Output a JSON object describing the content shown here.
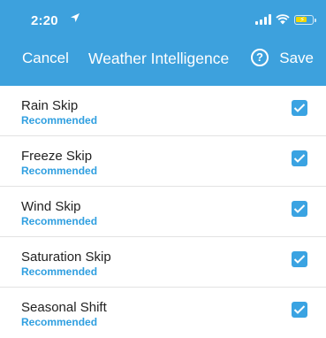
{
  "status_bar": {
    "time": "2:20",
    "icons": [
      "location-arrow-icon",
      "signal-icon",
      "wifi-icon",
      "battery-icon"
    ],
    "battery_color": "#f2d700"
  },
  "nav": {
    "cancel_label": "Cancel",
    "title": "Weather Intelligence",
    "help_label": "?",
    "save_label": "Save"
  },
  "colors": {
    "header": "#3da1dd",
    "accent": "#2f9fe0",
    "checkbox": "#3aa3e2"
  },
  "settings": [
    {
      "label": "Rain Skip",
      "tag": "Recommended",
      "checked": true
    },
    {
      "label": "Freeze Skip",
      "tag": "Recommended",
      "checked": true
    },
    {
      "label": "Wind Skip",
      "tag": "Recommended",
      "checked": true
    },
    {
      "label": "Saturation Skip",
      "tag": "Recommended",
      "checked": true
    },
    {
      "label": "Seasonal Shift",
      "tag": "Recommended",
      "checked": true
    }
  ]
}
